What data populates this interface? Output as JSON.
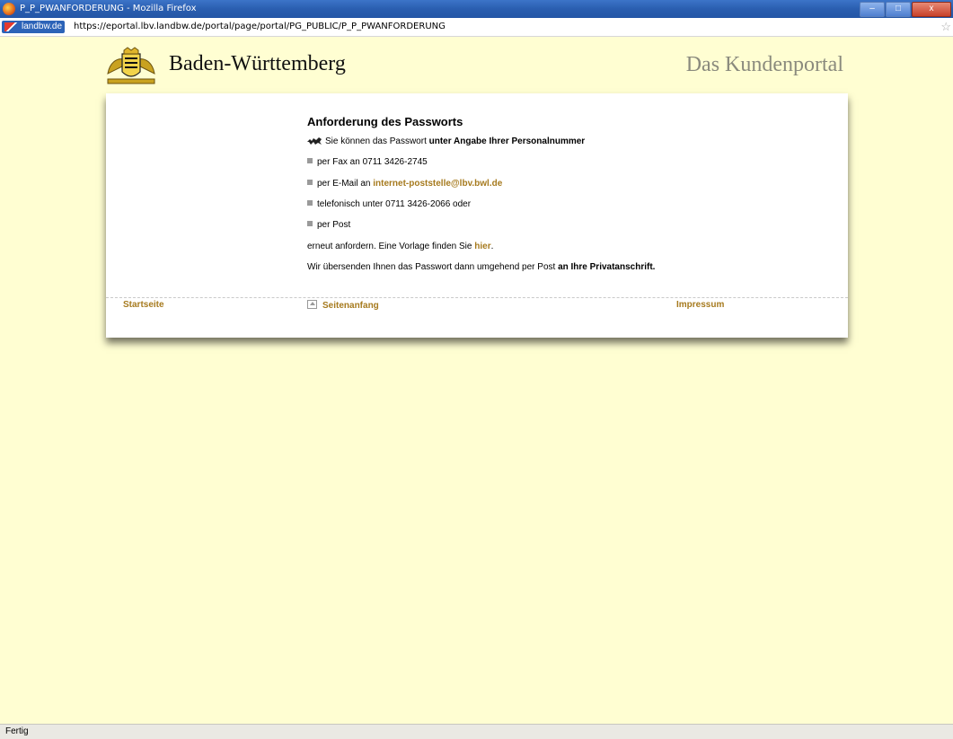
{
  "window": {
    "title": "P_P_PWANFORDERUNG - Mozilla Firefox"
  },
  "window_controls": {
    "minimize": "–",
    "maximize": "□",
    "close": "x"
  },
  "addressbar": {
    "site_identity": "landbw.de",
    "url": "https://eportal.lbv.landbw.de/portal/page/portal/PG_PUBLIC/P_P_PWANFORDERUNG",
    "bookmark_icon": "star-icon"
  },
  "header": {
    "brand": "Baden-Württemberg",
    "portal": "Das Kundenportal",
    "logo_icon": "coat-of-arms-icon"
  },
  "main": {
    "heading": "Anforderung des Passworts",
    "intro_prefix": "Sie können das Passwort ",
    "intro_bold": "unter Angabe Ihrer Personalnummer",
    "fax": "per Fax an 0711 3426-2745",
    "email_prefix": "per E-Mail an ",
    "email_link": "internet-poststelle@lbv.bwl.de",
    "phone": "telefonisch unter 0711 3426-2066 oder",
    "post": "per Post",
    "request_prefix": "erneut anfordern. Eine Vorlage finden Sie ",
    "request_link": "hier",
    "request_suffix": ".",
    "closing_prefix": "Wir übersenden Ihnen das Passwort dann umgehend per Post ",
    "closing_bold": "an Ihre Privatanschrift."
  },
  "footer": {
    "home": "Startseite",
    "top": "Seitenanfang",
    "imprint": "Impressum"
  },
  "statusbar": {
    "text": "Fertig"
  }
}
